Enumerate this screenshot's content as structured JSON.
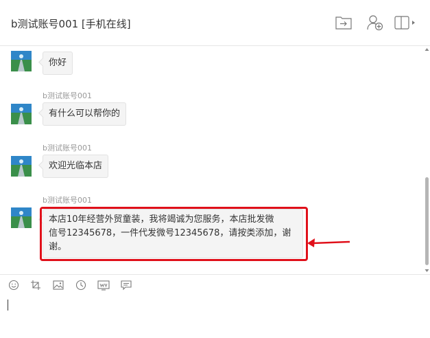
{
  "header": {
    "title": "b测试账号001 [手机在线]",
    "icons": [
      "transfer-icon",
      "add-user-icon",
      "layout-panel-icon"
    ]
  },
  "messages": [
    {
      "sender": "",
      "text": "你好"
    },
    {
      "sender": "b测试账号001",
      "text": "有什么可以帮你的"
    },
    {
      "sender": "b测试账号001",
      "text": "欢迎光临本店"
    },
    {
      "sender": "b测试账号001",
      "text_lines": [
        "本店10年经营外贸童装，我将竭诚为您服务，本店批发微",
        "信号12345678，一件代发微号12345678，请按类添加，谢",
        "谢。"
      ]
    }
  ],
  "toolbar": {
    "icons": [
      "emoji-icon",
      "screenshot-crop-icon",
      "image-icon",
      "history-clock-icon",
      "web-icon",
      "quick-reply-icon"
    ]
  },
  "colors": {
    "highlight": "#e0101a",
    "bubble": "#f4f4f4",
    "border": "#e6e6e6"
  },
  "input": {
    "value": ""
  }
}
